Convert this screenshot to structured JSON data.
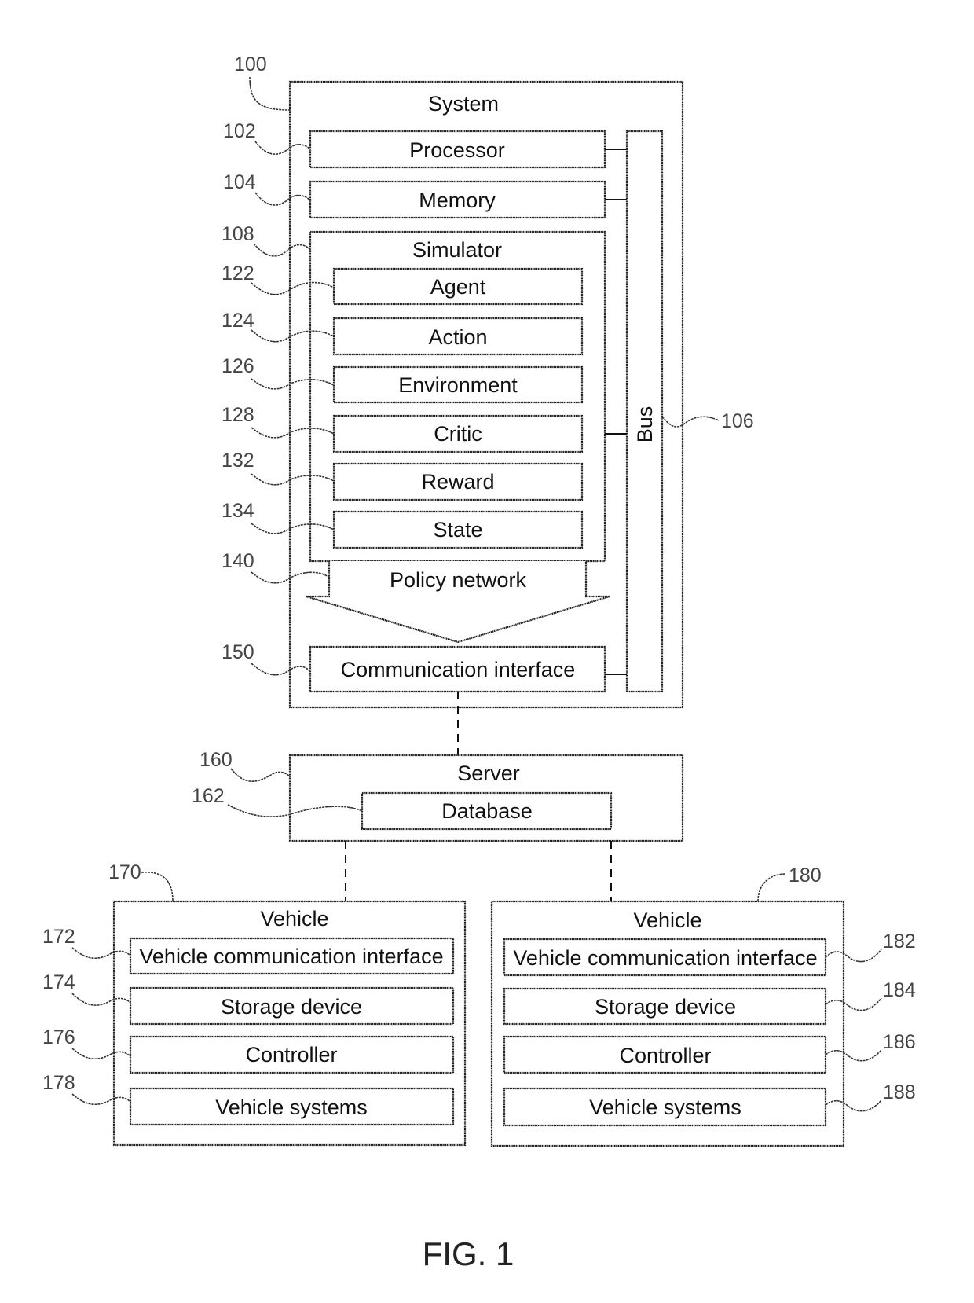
{
  "figure": {
    "caption": "FIG. 1"
  },
  "system": {
    "ref": "100",
    "title": "System",
    "processor": {
      "ref": "102",
      "label": "Processor"
    },
    "memory": {
      "ref": "104",
      "label": "Memory"
    },
    "bus": {
      "ref": "106",
      "label": "Bus"
    },
    "simulator": {
      "ref": "108",
      "title": "Simulator",
      "items": [
        {
          "ref": "122",
          "label": "Agent"
        },
        {
          "ref": "124",
          "label": "Action"
        },
        {
          "ref": "126",
          "label": "Environment"
        },
        {
          "ref": "128",
          "label": "Critic"
        },
        {
          "ref": "132",
          "label": "Reward"
        },
        {
          "ref": "134",
          "label": "State"
        }
      ]
    },
    "policy_network": {
      "ref": "140",
      "label": "Policy network"
    },
    "communication_interface": {
      "ref": "150",
      "label": "Communication interface"
    }
  },
  "server": {
    "ref": "160",
    "title": "Server",
    "database": {
      "ref": "162",
      "label": "Database"
    }
  },
  "vehicles": [
    {
      "ref": "170",
      "title": "Vehicle",
      "items": [
        {
          "ref": "172",
          "label": "Vehicle communication interface"
        },
        {
          "ref": "174",
          "label": "Storage device"
        },
        {
          "ref": "176",
          "label": "Controller"
        },
        {
          "ref": "178",
          "label": "Vehicle systems"
        }
      ]
    },
    {
      "ref": "180",
      "title": "Vehicle",
      "items": [
        {
          "ref": "182",
          "label": "Vehicle communication interface"
        },
        {
          "ref": "184",
          "label": "Storage device"
        },
        {
          "ref": "186",
          "label": "Controller"
        },
        {
          "ref": "188",
          "label": "Vehicle systems"
        }
      ]
    }
  ]
}
